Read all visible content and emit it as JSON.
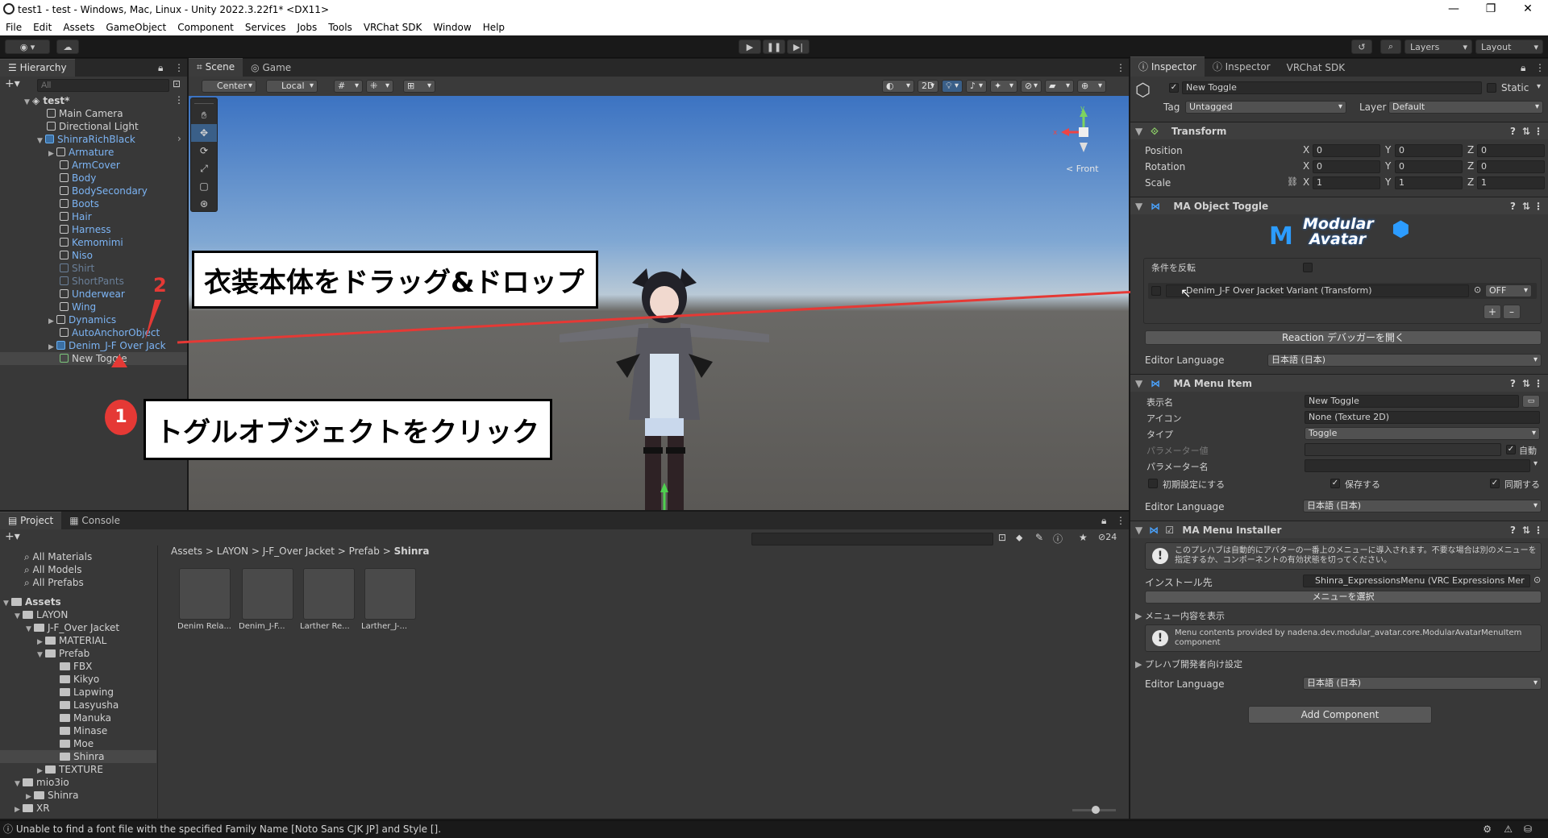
{
  "window": {
    "title": "test1 - test - Windows, Mac, Linux - Unity 2022.3.22f1* <DX11>"
  },
  "menu": [
    "File",
    "Edit",
    "Assets",
    "GameObject",
    "Component",
    "Services",
    "Jobs",
    "Tools",
    "VRChat SDK",
    "Window",
    "Help"
  ],
  "toolbar": {
    "layers": "Layers",
    "layout": "Layout"
  },
  "hierarchy": {
    "tab": "Hierarchy",
    "search_placeholder": "All",
    "scene": "test*",
    "items": [
      {
        "label": "Main Camera"
      },
      {
        "label": "Directional Light"
      },
      {
        "label": "ShinraRichBlack"
      },
      {
        "label": "Armature"
      },
      {
        "label": "ArmCover"
      },
      {
        "label": "Body"
      },
      {
        "label": "BodySecondary"
      },
      {
        "label": "Boots"
      },
      {
        "label": "Hair"
      },
      {
        "label": "Harness"
      },
      {
        "label": "Kemomimi"
      },
      {
        "label": "Niso"
      },
      {
        "label": "Shirt"
      },
      {
        "label": "ShortPants"
      },
      {
        "label": "Underwear"
      },
      {
        "label": "Wing"
      },
      {
        "label": "Dynamics"
      },
      {
        "label": "AutoAnchorObject"
      },
      {
        "label": "Denim_J-F Over Jack"
      },
      {
        "label": "New Toggle"
      }
    ]
  },
  "scene_view": {
    "tabs": [
      "Scene",
      "Game"
    ],
    "pivot": "Center",
    "space": "Local",
    "mode_2d": "2D",
    "gizmo_label": "< Front"
  },
  "callouts": {
    "drag": "衣装本体をドラッグ&ドロップ",
    "click": "トグルオブジェクトをクリック",
    "num1": "1",
    "num2": "2"
  },
  "project": {
    "tabs": [
      "Project",
      "Console"
    ],
    "favorites": [
      "All Materials",
      "All Models",
      "All Prefabs"
    ],
    "tree": [
      {
        "label": "Assets",
        "bold": true
      },
      {
        "label": "LAYON"
      },
      {
        "label": "J-F_Over Jacket"
      },
      {
        "label": "MATERIAL"
      },
      {
        "label": "Prefab"
      },
      {
        "label": "FBX"
      },
      {
        "label": "Kikyo"
      },
      {
        "label": "Lapwing"
      },
      {
        "label": "Lasyusha"
      },
      {
        "label": "Manuka"
      },
      {
        "label": "Minase"
      },
      {
        "label": "Moe"
      },
      {
        "label": "Shinra"
      },
      {
        "label": "TEXTURE"
      },
      {
        "label": "mio3io"
      },
      {
        "label": "Shinra"
      },
      {
        "label": "XR"
      }
    ],
    "breadcrumb": [
      "Assets",
      "LAYON",
      "J-F_Over Jacket",
      "Prefab",
      "Shinra"
    ],
    "assets": [
      "Denim Rela...",
      "Denim_J-F...",
      "Larther Re...",
      "Larther_J-..."
    ],
    "hidden_count": "24"
  },
  "inspector": {
    "tabs": [
      "Inspector",
      "Inspector",
      "VRChat SDK"
    ],
    "object_name": "New Toggle",
    "static_label": "Static",
    "tag_label": "Tag",
    "tag_value": "Untagged",
    "layer_label": "Layer",
    "layer_value": "Default",
    "transform": {
      "title": "Transform",
      "rows": [
        {
          "label": "Position",
          "x": "0",
          "y": "0",
          "z": "0"
        },
        {
          "label": "Rotation",
          "x": "0",
          "y": "0",
          "z": "0"
        },
        {
          "label": "Scale",
          "x": "1",
          "y": "1",
          "z": "1"
        }
      ]
    },
    "object_toggle": {
      "title": "MA Object Toggle",
      "logo_line1": "Modular",
      "logo_line2": "Avatar",
      "invert_label": "条件を反転",
      "entry_object": "Denim_J-F Over Jacket Variant (Transform)",
      "entry_state": "OFF",
      "reaction_button": "Reaction デバッガーを開く",
      "editor_language_label": "Editor Language",
      "editor_language_value": "日本語 (日本)"
    },
    "menu_item": {
      "title": "MA Menu Item",
      "display_name_label": "表示名",
      "display_name_value": "New Toggle",
      "icon_label": "アイコン",
      "icon_value": "None (Texture 2D)",
      "type_label": "タイプ",
      "type_value": "Toggle",
      "param_value_label": "パラメーター値",
      "auto_label": "自動",
      "param_name_label": "パラメーター名",
      "default_label": "初期設定にする",
      "saved_label": "保存する",
      "synced_label": "同期する",
      "editor_language_label": "Editor Language",
      "editor_language_value": "日本語 (日本)"
    },
    "menu_installer": {
      "title": "MA Menu Installer",
      "info": "このプレハブは自動的にアバターの一番上のメニューに導入されます。不要な場合は別のメニューを指定するか、コンポーネントの有効状態を切ってください。",
      "install_label": "インストール先",
      "install_value": "Shinra_ExpressionsMenu (VRC Expressions Mer",
      "select_menu_button": "メニューを選択",
      "show_menu_label": "メニュー内容を表示",
      "menu_info": "Menu contents provided by nadena.dev.modular_avatar.core.ModularAvatarMenuItem component",
      "prefab_dev_label": "プレハブ開発者向け設定",
      "editor_language_label": "Editor Language",
      "editor_language_value": "日本語 (日本)"
    },
    "add_component": "Add Component"
  },
  "status": {
    "message": "Unable to find a font file with the specified Family Name [Noto Sans CJK JP] and Style []."
  },
  "colors": {
    "accent_blue": "#2c5d87",
    "callout_red": "#e53935",
    "prefab_blue": "#7cb4f4"
  }
}
